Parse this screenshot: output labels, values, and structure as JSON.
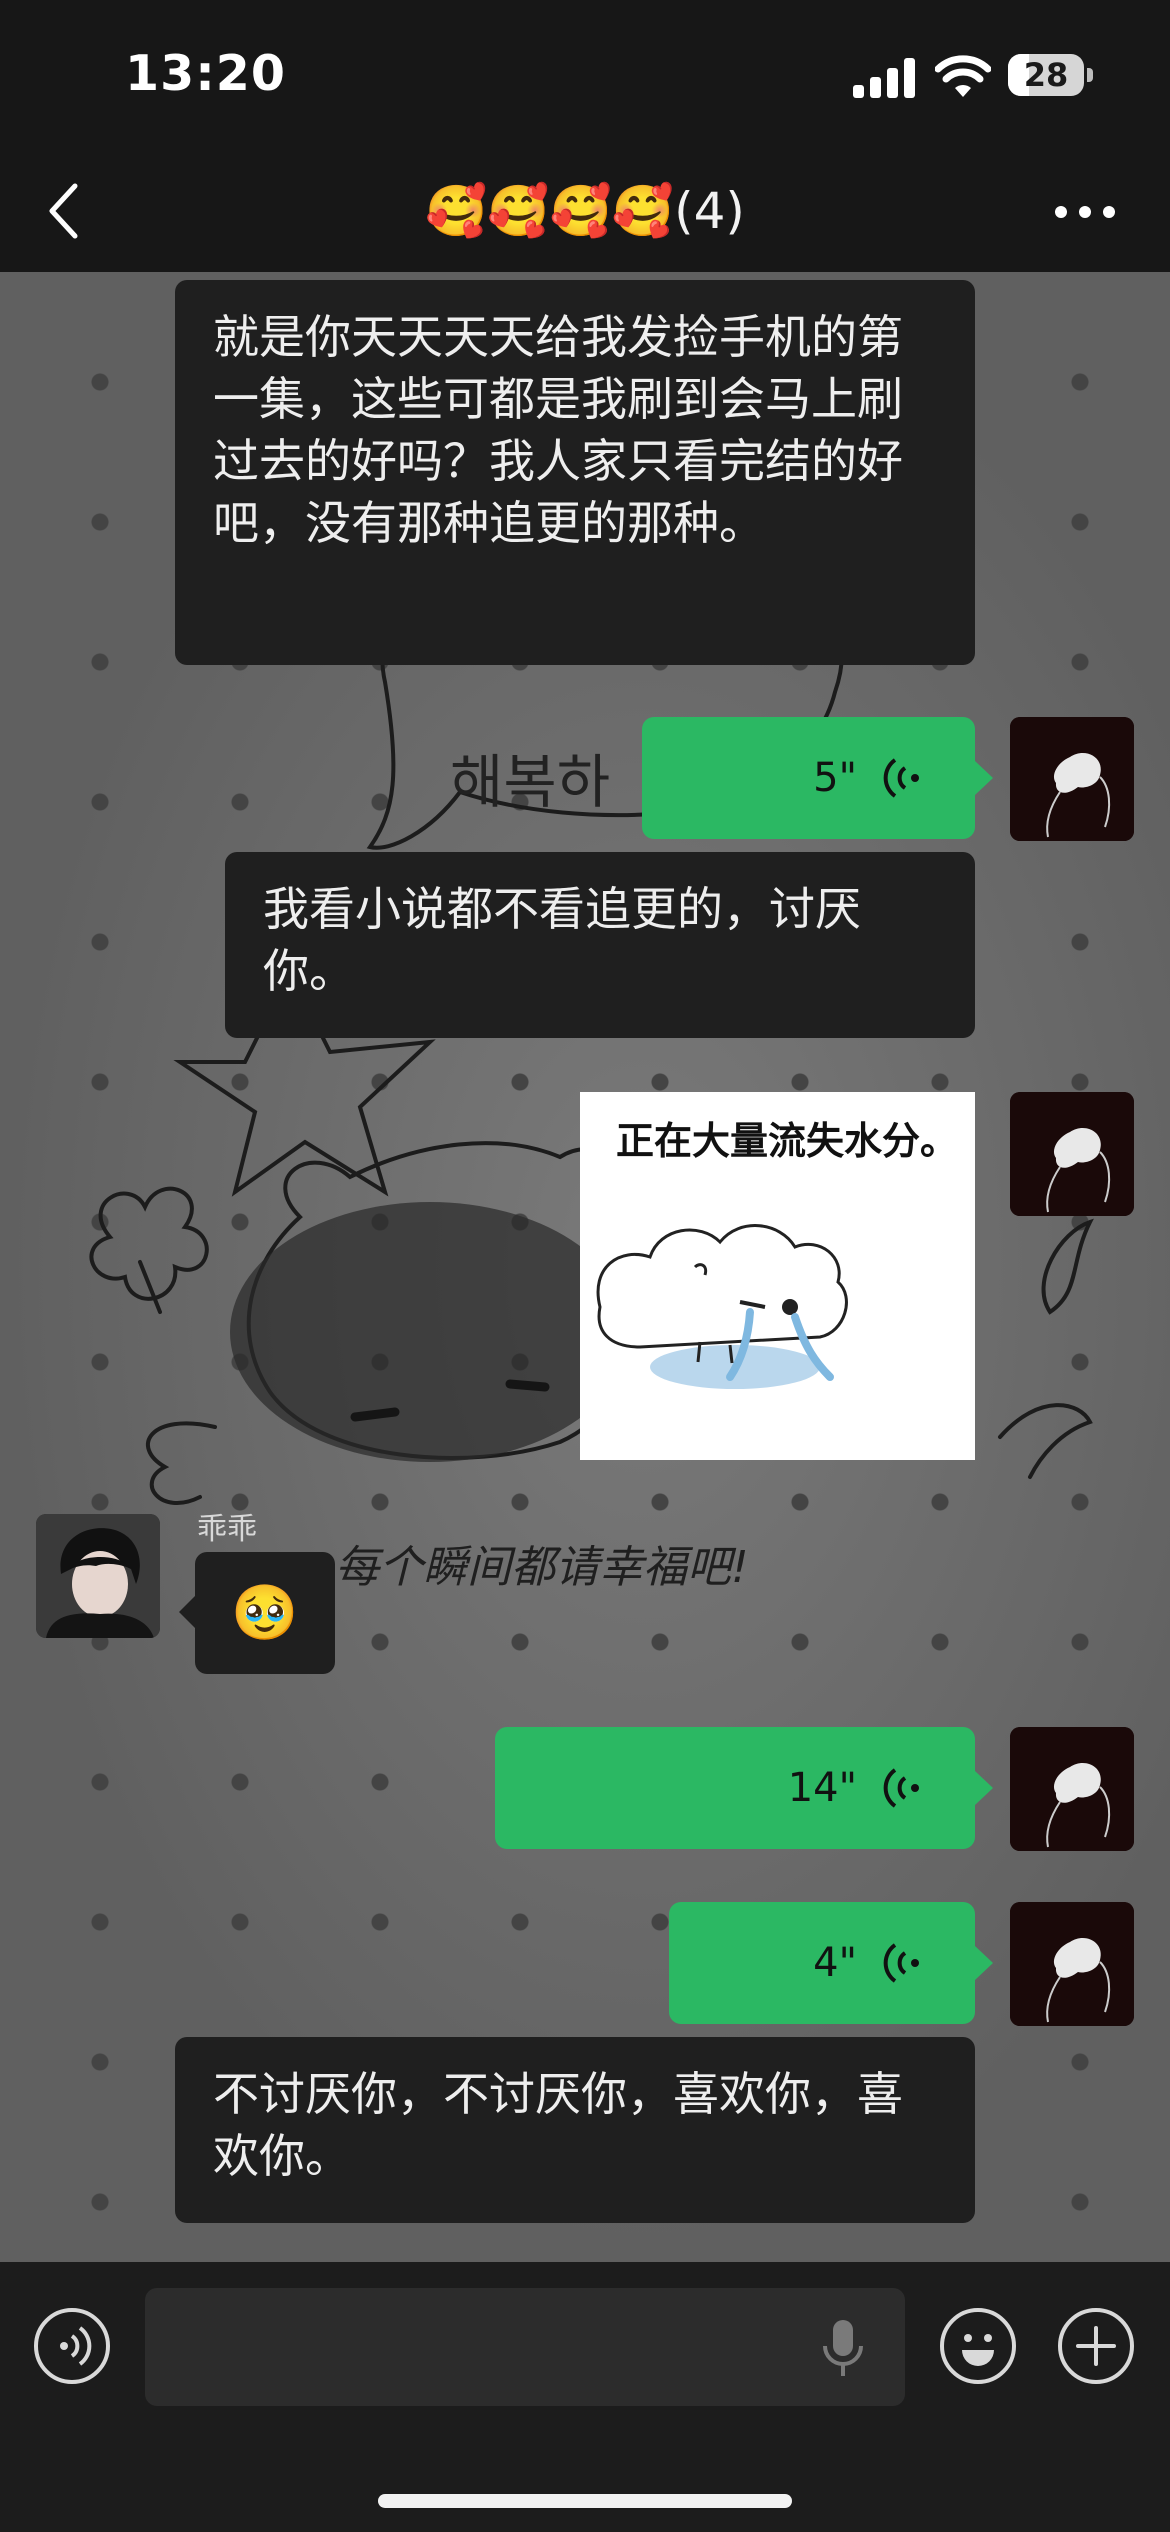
{
  "status_bar": {
    "time": "13:20",
    "battery_level": "28",
    "icons": [
      "signal-icon",
      "wifi-icon",
      "battery-icon"
    ]
  },
  "nav": {
    "back_icon": "chevron-left-icon",
    "title": "🥰🥰🥰🥰(4)",
    "more_icon": "ellipsis-icon"
  },
  "messages": [
    {
      "side": "left",
      "type": "text",
      "text": "就是你天天天天给我发捡手机的第一集，这些可都是我刷到会马上刷过去的好吗？我人家只看完结的好吧，没有那种追更的那种。"
    },
    {
      "side": "right",
      "type": "voice",
      "duration": "5\""
    },
    {
      "side": "left",
      "type": "text",
      "text": "我看小说都不看追更的，讨厌你。"
    },
    {
      "side": "right",
      "type": "sticker",
      "caption": "正在大量流失水分。"
    },
    {
      "side": "left",
      "type": "emoji",
      "sender": "乖乖",
      "text": "🥹"
    },
    {
      "side": "right",
      "type": "voice",
      "duration": "14\""
    },
    {
      "side": "right",
      "type": "voice",
      "duration": "4\""
    },
    {
      "side": "left",
      "type": "text",
      "text": "不讨厌你，不讨厌你，喜欢你，喜欢你。"
    }
  ],
  "background_text": {
    "line1": "해복하",
    "line2": "每个瞬间都请幸福吧!"
  },
  "input_bar": {
    "voice_icon": "voice-mode-icon",
    "mic_icon": "microphone-icon",
    "emoji_icon": "smiley-icon",
    "plus_icon": "plus-icon"
  },
  "colors": {
    "sent_bubble": "#2bb863",
    "received_bubble": "#1f1f1f",
    "bars": "#171717"
  }
}
